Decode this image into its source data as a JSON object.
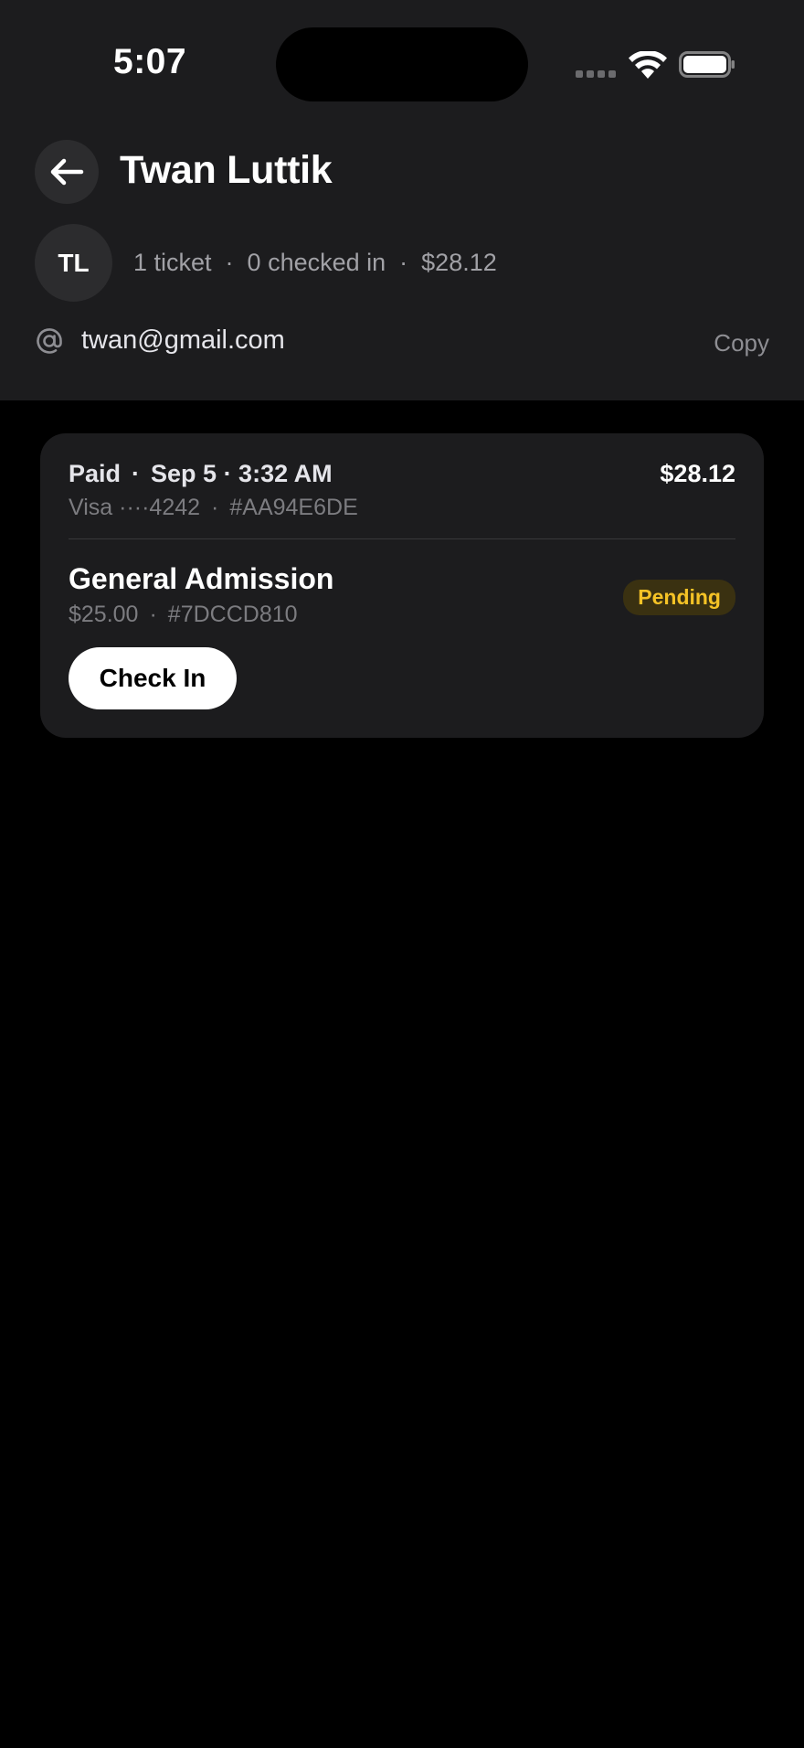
{
  "status_bar": {
    "time": "5:07"
  },
  "header": {
    "title": "Twan Luttik",
    "back_icon": "arrow-left-icon",
    "avatar_initials": "TL",
    "summary": {
      "tickets": "1 ticket",
      "checked_in": "0 checked in",
      "total": "$28.12",
      "separator": "·"
    },
    "email": "twan@gmail.com",
    "email_icon": "at-icon",
    "copy_label": "Copy"
  },
  "order": {
    "status": "Paid",
    "date": "Sep 5 · 3:32 AM",
    "amount": "$28.12",
    "card": "Visa ····4242",
    "order_id": "#AA94E6DE",
    "separator": "·",
    "ticket": {
      "name": "General Admission",
      "price": "$25.00",
      "ticket_id": "#7DCCD810",
      "status": "Pending",
      "action_label": "Check In"
    }
  },
  "colors": {
    "background": "#000000",
    "surface": "#1c1c1e",
    "pending_text": "#f5c326",
    "pending_bg": "#3a3111"
  }
}
